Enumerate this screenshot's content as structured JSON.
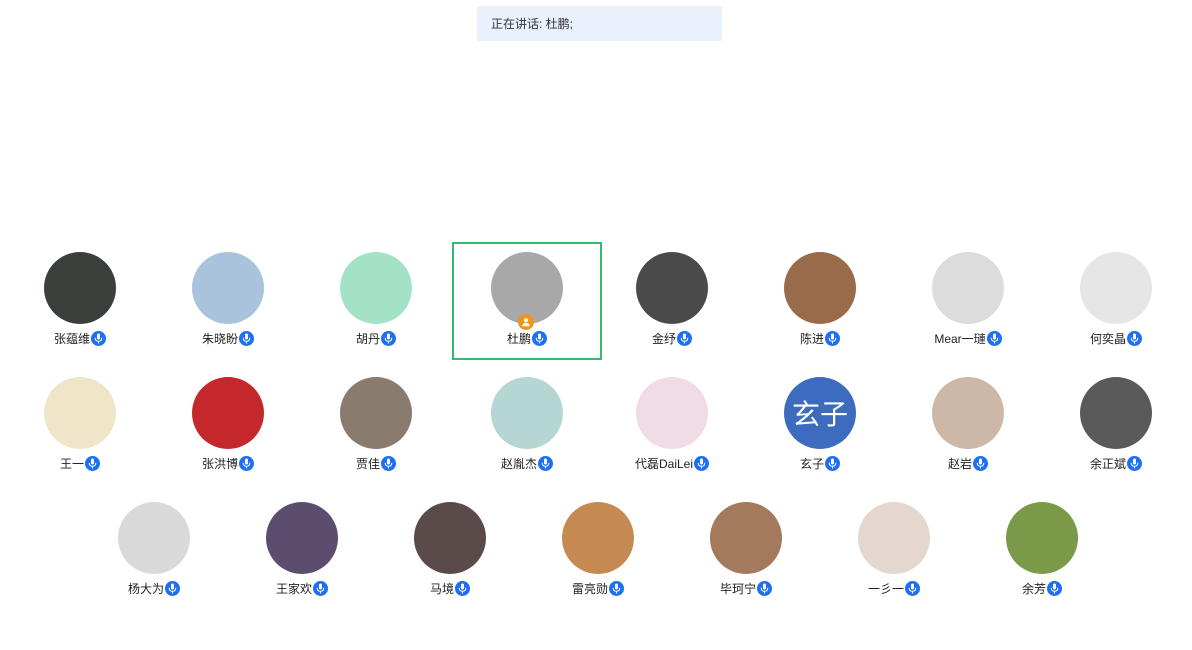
{
  "banner": {
    "text": "正在讲话: 杜鹏;"
  },
  "participants": [
    {
      "name": "张蕴维",
      "avatar": "photo-night-street",
      "color": "#3b3f3c"
    },
    {
      "name": "朱晓盼",
      "avatar": "photo-girl-reeds",
      "color": "#a9c3dc"
    },
    {
      "name": "胡丹",
      "avatar": "solid-green",
      "color": "#a4e2c6"
    },
    {
      "name": "杜鹏",
      "avatar": "photo-grey-blur",
      "color": "#a8a8a8",
      "active": true,
      "host": true,
      "speaking": true
    },
    {
      "name": "金纾",
      "avatar": "photo-cat-dark",
      "color": "#4a4a4a"
    },
    {
      "name": "陈进",
      "avatar": "photo-sunset-tree",
      "color": "#9a6b4b"
    },
    {
      "name": "Mear一璉",
      "avatar": "photo-girl-face",
      "color": "#dcdcdc"
    },
    {
      "name": "何奕晶",
      "avatar": "photo-child-hat",
      "color": "#e6e6e6"
    },
    {
      "name": "王一",
      "avatar": "sketch-man-glasses",
      "color": "#efe6c9"
    },
    {
      "name": "张洪博",
      "avatar": "art-red-figure",
      "color": "#c5282c"
    },
    {
      "name": "贾佳",
      "avatar": "photo-woman-portrait",
      "color": "#8a7b6f"
    },
    {
      "name": "赵胤杰",
      "avatar": "solid-teal",
      "color": "#b5d6d2"
    },
    {
      "name": "代磊DaiLei",
      "avatar": "cartoon-sunglasses",
      "color": "#f1dbe7"
    },
    {
      "name": "玄子",
      "avatar": "text-avatar",
      "avatar_text": "玄子",
      "color": "#3d6cbe"
    },
    {
      "name": "赵岩",
      "avatar": "painting-baby",
      "color": "#cdb8a8"
    },
    {
      "name": "余正斌",
      "avatar": "photo-girl-scarf",
      "color": "#5a5a5a"
    },
    {
      "name": "杨大为",
      "avatar": "photo-objects-white",
      "color": "#d9d9d9"
    },
    {
      "name": "王家欢",
      "avatar": "texture-purple",
      "color": "#5c4d6f"
    },
    {
      "name": "马境",
      "avatar": "illustration-girl-cat",
      "color": "#5b4a4a"
    },
    {
      "name": "雷亮勋",
      "avatar": "photo-sunset-sky",
      "color": "#c58a52"
    },
    {
      "name": "毕珂宁",
      "avatar": "photo-boy",
      "color": "#a37a5c"
    },
    {
      "name": "一彡一",
      "avatar": "illustration-couple",
      "color": "#e3d7cf"
    },
    {
      "name": "余芳",
      "avatar": "photo-lotus",
      "color": "#7a9a4a"
    }
  ],
  "icons": {
    "mic": "microphone-icon",
    "host": "host-person-icon"
  },
  "colors": {
    "active_border": "#2fbd6b",
    "mic_badge": "#1e6ff1",
    "host_badge": "#f0941f",
    "banner_bg": "#e9f1fd"
  }
}
